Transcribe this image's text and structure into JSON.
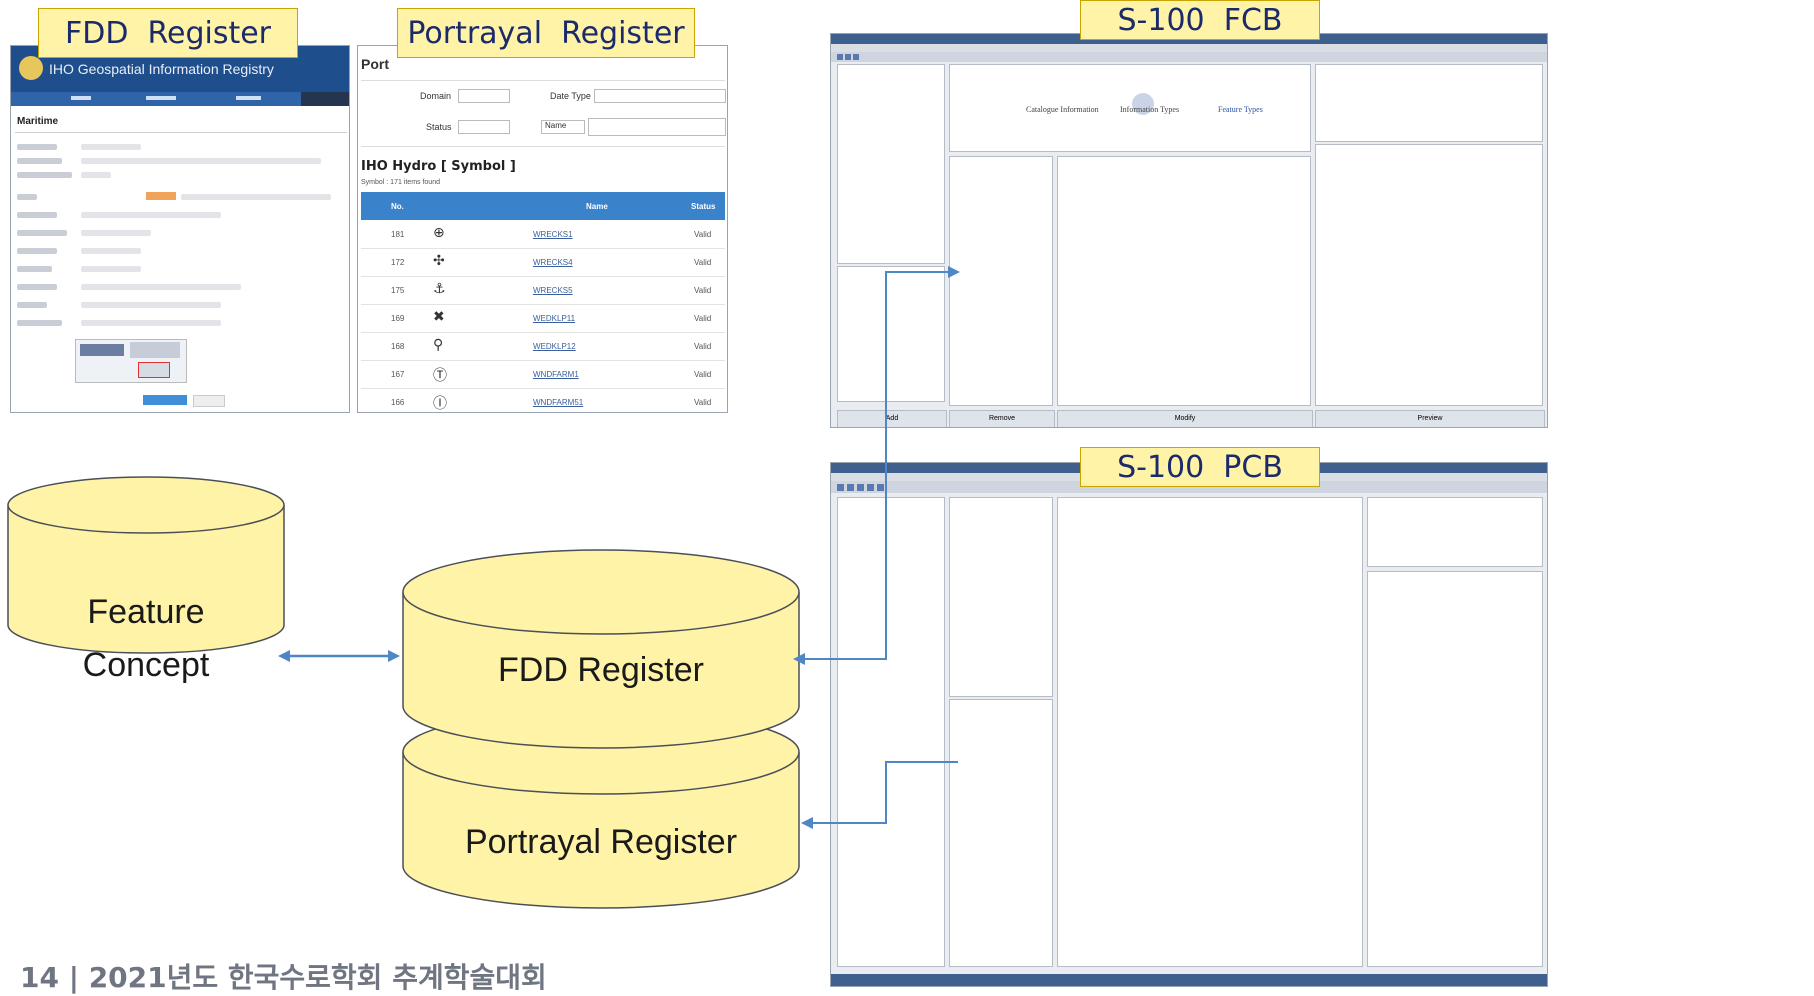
{
  "labels": {
    "fdd_register": "FDD  Register",
    "portrayal_register": "Portrayal  Register",
    "s100_fcb": "S-100  FCB",
    "s100_pcb": "S-100  PCB"
  },
  "fdd_screenshot": {
    "header_title": "IHO Geospatial Information Registry",
    "section_title": "Maritime"
  },
  "portrayal_screenshot": {
    "page_title_fragment": "Port",
    "filter_domain_label": "Domain",
    "filter_date_type_label": "Date Type",
    "filter_status_label": "Status",
    "filter_name_select": "Name",
    "list_title": "IHO Hydro [ Symbol ]",
    "list_summary": "Symbol : 171 items found",
    "columns": [
      "No.",
      "Name",
      "Status"
    ],
    "rows": [
      {
        "no": "181",
        "name": "WRECKS1",
        "status": "Valid"
      },
      {
        "no": "172",
        "name": "WRECKS4",
        "status": "Valid"
      },
      {
        "no": "175",
        "name": "WRECKS5",
        "status": "Valid"
      },
      {
        "no": "169",
        "name": "WEDKLP11",
        "status": "Valid"
      },
      {
        "no": "168",
        "name": "WEDKLP12",
        "status": "Valid"
      },
      {
        "no": "167",
        "name": "WNDFARM1",
        "status": "Valid"
      },
      {
        "no": "166",
        "name": "WNDFARM51",
        "status": "Valid"
      }
    ]
  },
  "fcb_screenshot": {
    "center_items": [
      "Catalogue Information",
      "Information Types",
      "Feature Types"
    ],
    "bottom_labels": [
      "Add",
      "Remove",
      "Modify",
      "Preview"
    ]
  },
  "pcb_screenshot": {},
  "cylinders": {
    "feature_concept_line1": "Feature",
    "feature_concept_line2": "Concept",
    "fdd_register": "FDD Register",
    "portrayal_register": "Portrayal Register"
  },
  "footer": {
    "text": "14 | 2021년도 한국수로학회 추계학술대회"
  },
  "colors": {
    "cylinder_fill": "#fff3a8",
    "cylinder_stroke": "#4a4f58",
    "arrow": "#4f86c6",
    "label_fill": "#fff3a8"
  }
}
